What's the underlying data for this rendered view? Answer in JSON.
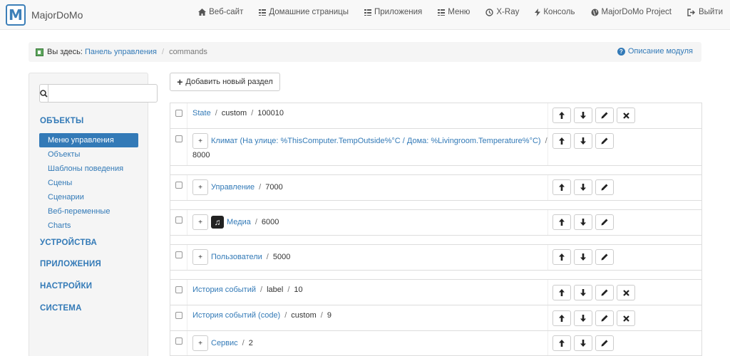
{
  "brand": {
    "logo_letter": "M",
    "name": "MajorDoMo"
  },
  "nav": [
    {
      "label": "Веб-сайт",
      "icon": "home-icon"
    },
    {
      "label": "Домашние страницы",
      "icon": "grid-icon"
    },
    {
      "label": "Приложения",
      "icon": "grid-icon"
    },
    {
      "label": "Меню",
      "icon": "grid-icon"
    },
    {
      "label": "X-Ray",
      "icon": "clock-icon"
    },
    {
      "label": "Консоль",
      "icon": "bolt-icon"
    },
    {
      "label": "MajorDoMo Project",
      "icon": "globe-icon"
    },
    {
      "label": "Выйти",
      "icon": "logout-icon"
    }
  ],
  "breadcrumb": {
    "prefix": "Вы здесь:",
    "link": "Панель управления",
    "separator": "/",
    "current": "commands",
    "help": "Описание модуля"
  },
  "sidebar": {
    "search_placeholder": "",
    "sections": [
      {
        "label": "ОБЪЕКТЫ"
      },
      {
        "label": "УСТРОЙСТВА"
      },
      {
        "label": "ПРИЛОЖЕНИЯ"
      },
      {
        "label": "НАСТРОЙКИ"
      },
      {
        "label": "СИСТЕМА"
      }
    ],
    "items": [
      {
        "label": "Меню управления",
        "active": true
      },
      {
        "label": "Объекты"
      },
      {
        "label": "Шаблоны поведения"
      },
      {
        "label": "Сцены"
      },
      {
        "label": "Сценарии"
      },
      {
        "label": "Веб-переменные"
      },
      {
        "label": "Charts"
      }
    ]
  },
  "main": {
    "add_button": "Добавить новый раздел",
    "rows": [
      {
        "title": "State",
        "parts": [
          "custom",
          "100010"
        ]
      },
      {
        "title": "Климат (На улице: %ThisComputer.TempOutside%°C / Дома: %Livingroom.Temperature%°C)",
        "parts": [],
        "second_line": "8000"
      },
      {
        "title": "Управление",
        "parts": [
          "7000"
        ]
      },
      {
        "title": "Медиа",
        "parts": [
          "6000"
        ]
      },
      {
        "title": "Пользователи",
        "parts": [
          "5000"
        ]
      },
      {
        "title": "История событий",
        "parts": [
          "label",
          "10"
        ]
      },
      {
        "title": "История событий (code)",
        "parts": [
          "custom",
          "9"
        ]
      },
      {
        "title": "Сервис",
        "parts": [
          "2"
        ]
      }
    ],
    "expand_label": "+",
    "separator": "/"
  },
  "colors": {
    "accent": "#337ab7",
    "navbar_bg": "#f8f8f8",
    "panel_bg": "#f5f5f5"
  }
}
